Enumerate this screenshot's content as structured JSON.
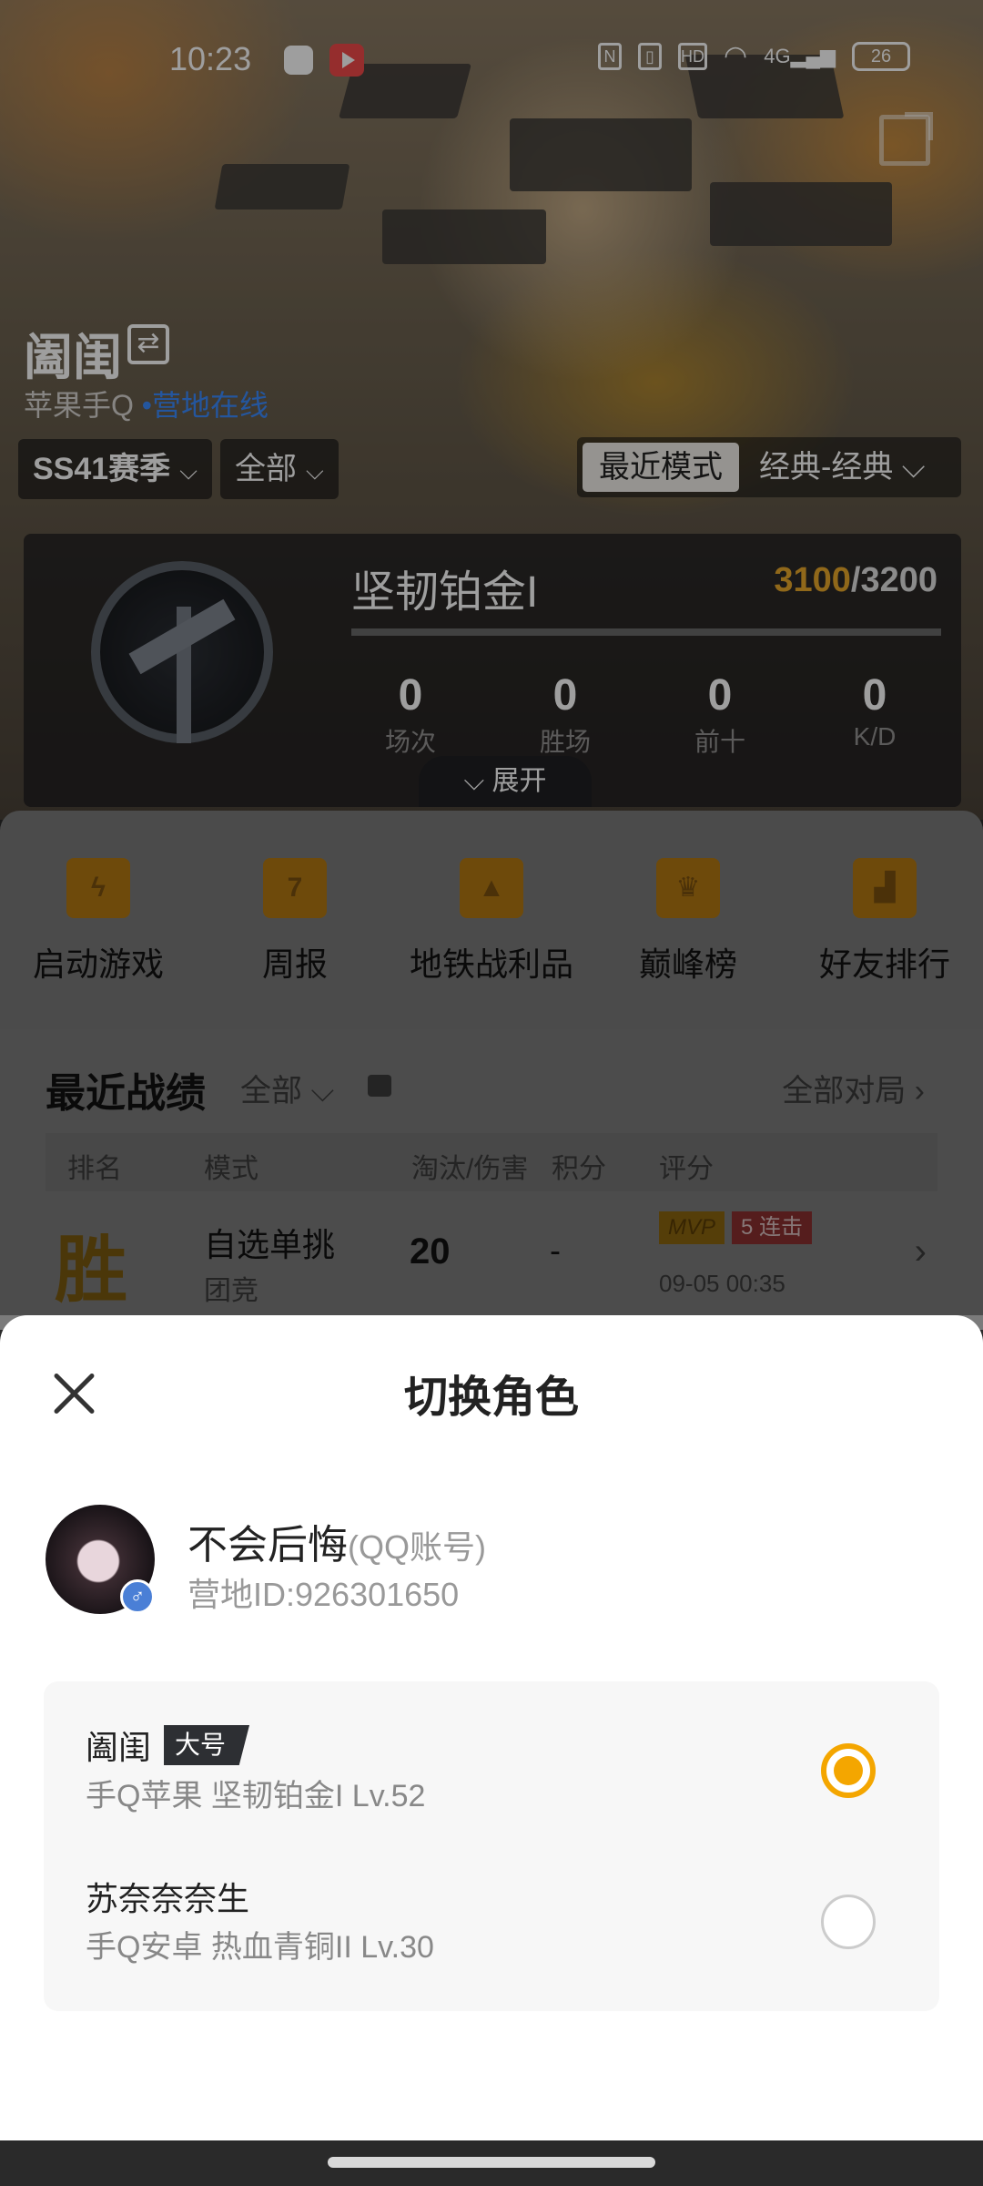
{
  "status_bar": {
    "time": "10:23",
    "network": "4G",
    "hd": "HD",
    "battery": "26"
  },
  "profile": {
    "name": "阖闺",
    "platform": "苹果手Q",
    "camp_status": "营地在线",
    "season": "SS41赛季",
    "filter": "全部",
    "mode_active": "最近模式",
    "mode_other": "经典-经典"
  },
  "rank": {
    "title": "坚韧铂金I",
    "score_current": "3100",
    "score_total": "/3200",
    "stats": [
      {
        "value": "0",
        "label": "场次"
      },
      {
        "value": "0",
        "label": "胜场"
      },
      {
        "value": "0",
        "label": "前十"
      },
      {
        "value": "0",
        "label": "K/D"
      }
    ],
    "expand_label": "展开"
  },
  "features": [
    {
      "label": "启动游戏",
      "icon": "lightning-icon"
    },
    {
      "label": "周报",
      "icon": "calendar-icon",
      "badge": "7"
    },
    {
      "label": "地铁战利品",
      "icon": "shield-icon"
    },
    {
      "label": "巅峰榜",
      "icon": "trophy-icon"
    },
    {
      "label": "好友排行",
      "icon": "podium-icon"
    }
  ],
  "records": {
    "title": "最近战绩",
    "filter": "全部",
    "all_games": "全部对局",
    "headers": [
      "排名",
      "模式",
      "淘汰/伤害",
      "积分",
      "评分"
    ],
    "rows": [
      {
        "rank": "胜",
        "mode": "自选单挑",
        "sub": "团竞",
        "kills": "20",
        "score": "-",
        "mvp": "MVP",
        "combo": "5 连击",
        "date": "09-05 00:35"
      }
    ]
  },
  "sheet": {
    "title": "切换角色",
    "account": {
      "name": "不会后悔",
      "type": "(QQ账号)",
      "camp_id": "营地ID:926301650"
    },
    "roles": [
      {
        "name": "阖闺",
        "tag": "大号",
        "info": "手Q苹果  坚韧铂金I  Lv.52",
        "selected": true
      },
      {
        "name": "苏奈奈奈生",
        "tag": "",
        "info": "手Q安卓  热血青铜II  Lv.30",
        "selected": false
      }
    ]
  },
  "colors": {
    "accent": "#f4a600",
    "camp_link": "#3b8bff",
    "gold": "#e8a82a"
  }
}
